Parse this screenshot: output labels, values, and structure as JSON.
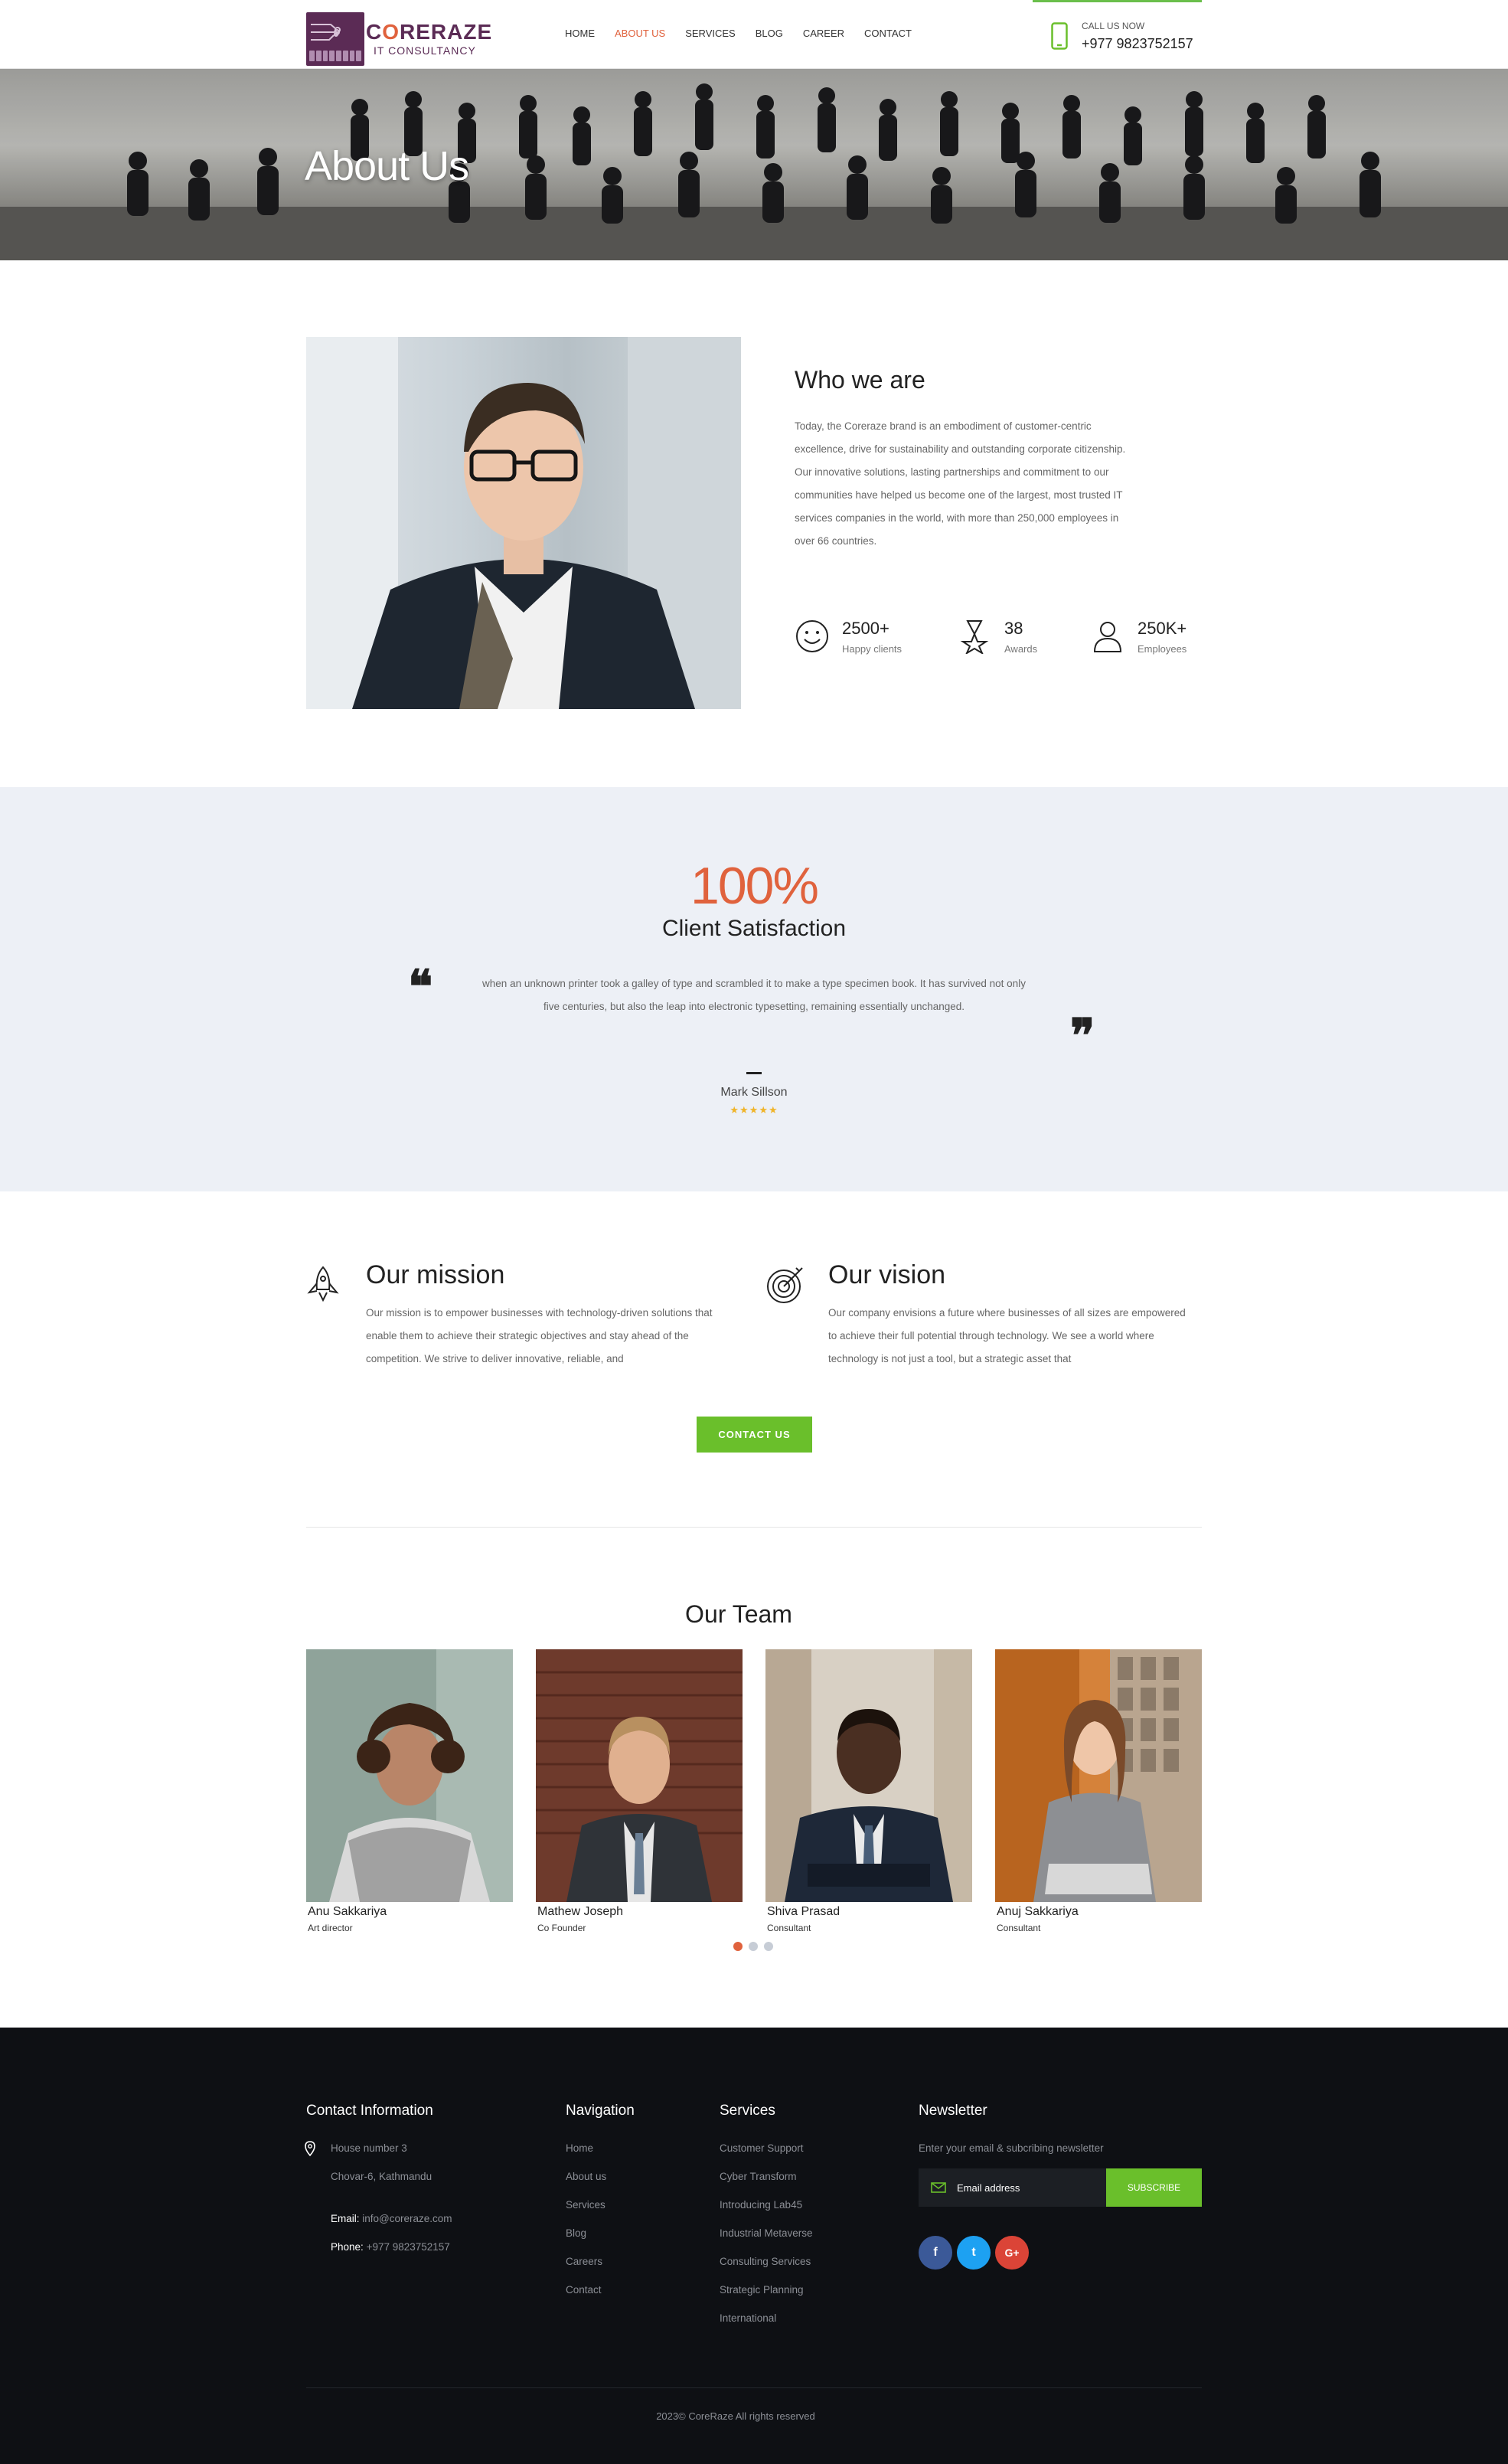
{
  "header": {
    "brand_name": "CORERAZE",
    "brand_sub": "IT CONSULTANCY",
    "nav": [
      "HOME",
      "ABOUT US",
      "SERVICES",
      "BLOG",
      "CAREER",
      "CONTACT"
    ],
    "active_nav": "ABOUT US",
    "call_label": "CALL US NOW",
    "call_number": "+977 9823752157",
    "accent": "#e0623d",
    "green": "#6abf2b"
  },
  "hero": {
    "title": "About Us"
  },
  "who": {
    "title": "Who we are",
    "text": "Today, the Coreraze brand is an embodiment of customer-centric excellence, drive for sustainability and outstanding corporate citizenship. Our innovative solutions, lasting partnerships and commitment to our communities have helped us become one of the largest, most trusted IT services companies in the world, with more than 250,000 employees in over 66 countries.",
    "stats": [
      {
        "icon": "smiley-icon",
        "value": "2500+",
        "label": "Happy clients"
      },
      {
        "icon": "award-icon",
        "value": "38",
        "label": "Awards"
      },
      {
        "icon": "person-icon",
        "value": "250K+",
        "label": "Employees"
      }
    ]
  },
  "testimonial": {
    "percent": "100%",
    "label": "Client Satisfaction",
    "quote": "when an unknown printer took a galley of type and scrambled it to make a type specimen book. It has survived not only five centuries, but also the leap into electronic typesetting, remaining essentially unchanged.",
    "author": "Mark Sillson",
    "stars": "★★★★★"
  },
  "mission": {
    "title": "Our mission",
    "text": "Our mission is to empower businesses with technology-driven solutions that enable them to achieve their strategic objectives and stay ahead of the competition. We strive to deliver innovative, reliable, and"
  },
  "vision": {
    "title": "Our vision",
    "text": "Our company envisions a future where businesses of all sizes are empowered to achieve their full potential through technology. We see a world where technology is not just a tool, but a strategic asset that"
  },
  "contact_button": "CONTACT US",
  "team": {
    "title": "Our Team",
    "members": [
      {
        "name": "Anu Sakkariya",
        "role": "Art director"
      },
      {
        "name": "Mathew Joseph",
        "role": "Co Founder"
      },
      {
        "name": "Shiva Prasad",
        "role": "Consultant"
      },
      {
        "name": "Anuj  Sakkariya",
        "role": "Consultant"
      }
    ]
  },
  "footer": {
    "contact": {
      "heading": "Contact Information",
      "address_line1": "House number 3",
      "address_line2": "Chovar-6, Kathmandu",
      "email_label": "Email:",
      "email": "info@coreraze.com",
      "phone_label": "Phone:",
      "phone": "+977 9823752157"
    },
    "navigation": {
      "heading": "Navigation",
      "links": [
        "Home",
        "About us",
        "Services",
        "Blog",
        "Careers",
        "Contact"
      ]
    },
    "services": {
      "heading": "Services",
      "links": [
        "Customer Support",
        "Cyber Transform",
        "Introducing Lab45",
        "Industrial Metaverse",
        "Consulting Services",
        "Strategic Planning",
        "International"
      ]
    },
    "newsletter": {
      "heading": "Newsletter",
      "text": "Enter your email & subcribing newsletter",
      "placeholder": "Email address",
      "button": "SUBSCRIBE"
    },
    "social": [
      "f",
      "t",
      "G+"
    ],
    "copyright": "2023© CoreRaze  All rights reserved"
  }
}
